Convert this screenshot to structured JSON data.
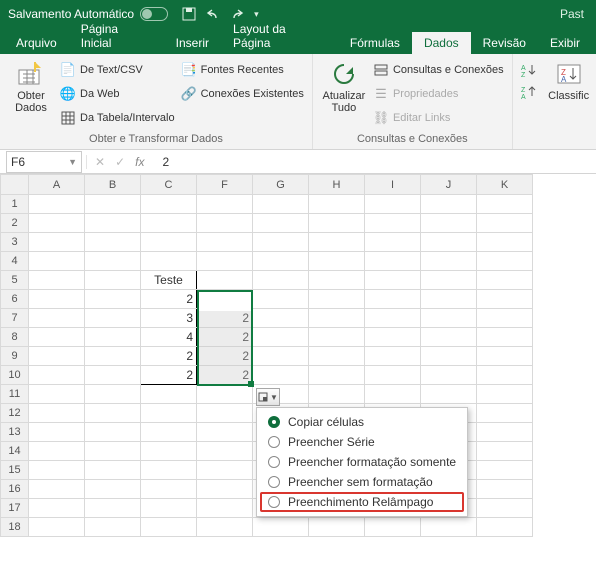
{
  "titlebar": {
    "autosave": "Salvamento Automático",
    "doc": "Past"
  },
  "tabs": [
    "Arquivo",
    "Página Inicial",
    "Inserir",
    "Layout da Página",
    "Fórmulas",
    "Dados",
    "Revisão",
    "Exibir"
  ],
  "active_tab": 5,
  "ribbon": {
    "group1": {
      "label": "Obter e Transformar Dados",
      "obter": "Obter\nDados",
      "items": [
        "De Text/CSV",
        "Da Web",
        "Da Tabela/Intervalo",
        "Fontes Recentes",
        "Conexões Existentes"
      ]
    },
    "group2": {
      "label": "Consultas e Conexões",
      "atualizar": "Atualizar\nTudo",
      "items": [
        "Consultas e Conexões",
        "Propriedades",
        "Editar Links"
      ]
    },
    "group3": {
      "classificar": "Classific"
    }
  },
  "formula": {
    "name": "F6",
    "value": "2"
  },
  "columns": [
    "A",
    "B",
    "C",
    "F",
    "G",
    "H",
    "I",
    "J",
    "K"
  ],
  "rows": 18,
  "sheet": {
    "header": "Teste",
    "colC": [
      "2",
      "3",
      "4",
      "2",
      "2"
    ],
    "colF": [
      "2",
      "2",
      "2",
      "2",
      "2"
    ]
  },
  "autofill": {
    "items": [
      "Copiar células",
      "Preencher Série",
      "Preencher formatação somente",
      "Preencher sem formatação",
      "Preenchimento Relâmpago"
    ],
    "selected": 0,
    "highlight": 4
  }
}
